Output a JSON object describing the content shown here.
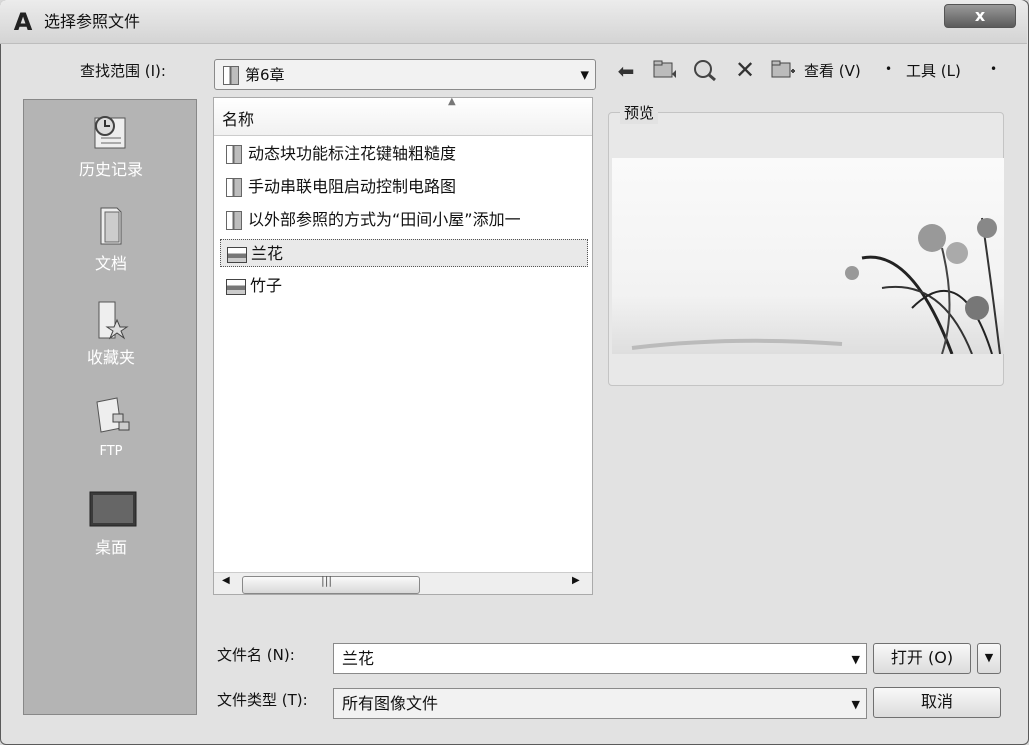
{
  "window": {
    "title": "选择参照文件",
    "close_label": "x"
  },
  "look_in": {
    "label": "查找范围 (I):",
    "value": "第6章"
  },
  "toolbar": {
    "view_label": "查看 (V)",
    "tools_label": "工具 (L)"
  },
  "places": [
    {
      "label": "历史记录",
      "icon": "history-icon"
    },
    {
      "label": "文档",
      "icon": "documents-icon"
    },
    {
      "label": "收藏夹",
      "icon": "favorites-icon"
    },
    {
      "label": "FTP",
      "icon": "ftp-icon"
    },
    {
      "label": "桌面",
      "icon": "desktop-icon"
    }
  ],
  "file_list": {
    "column_header": "名称",
    "items": [
      {
        "name": "动态块功能标注花键轴粗糙度",
        "type": "folder"
      },
      {
        "name": "手动串联电阻启动控制电路图",
        "type": "folder"
      },
      {
        "name": "以外部参照的方式为“田间小屋”添加一",
        "type": "folder"
      },
      {
        "name": "兰花",
        "type": "image",
        "selected": true
      },
      {
        "name": "竹子",
        "type": "image"
      }
    ]
  },
  "preview": {
    "label": "预览"
  },
  "filename": {
    "label": "文件名 (N):",
    "value": "兰花"
  },
  "filetype": {
    "label": "文件类型 (T):",
    "value": "所有图像文件"
  },
  "buttons": {
    "open": "打开 (O)",
    "cancel": "取消"
  }
}
